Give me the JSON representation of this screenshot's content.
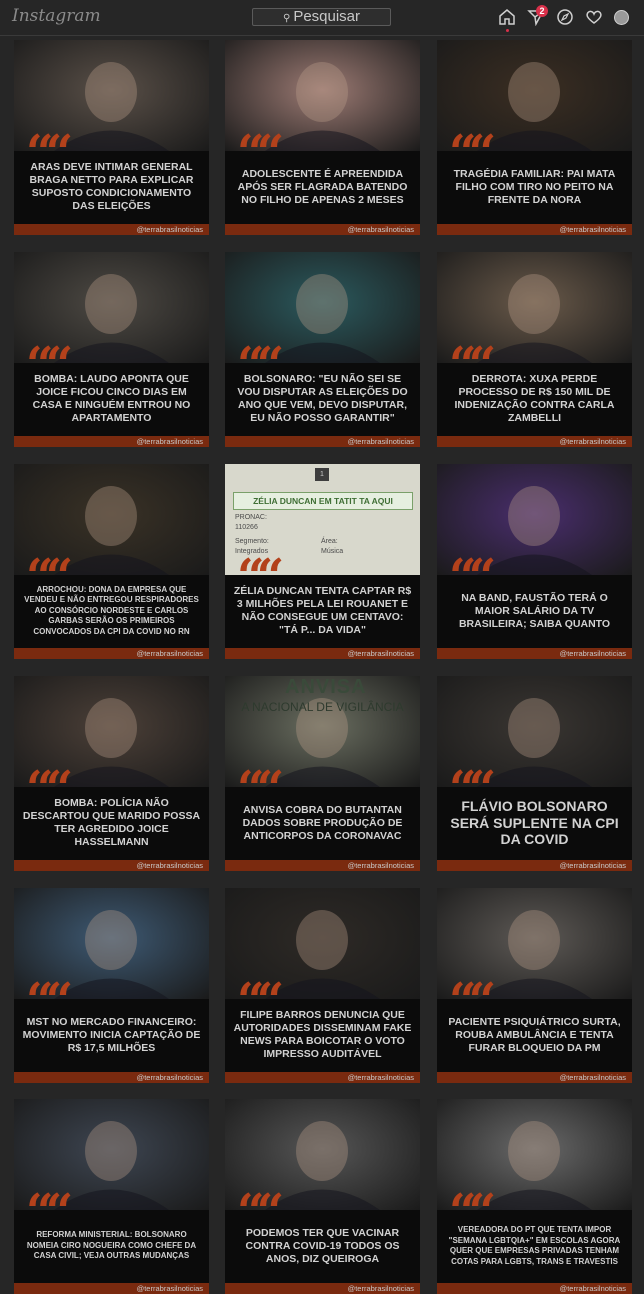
{
  "app": {
    "logo_text": "Instagram"
  },
  "search": {
    "placeholder": "Pesquisar"
  },
  "nav": {
    "notification_count": "2",
    "icons": [
      "home-icon",
      "direct-icon",
      "explore-icon",
      "heart-icon",
      "avatar"
    ]
  },
  "colors": {
    "accent": "#b3411b",
    "footer": "#7a2a0f",
    "badge": "#d9304a"
  },
  "handle": "@terrabrasilnoticias",
  "posts": [
    {
      "headline": "Aras deve intimar general Braga Netto para explicar suposto condicionamento das eleições",
      "photo": "portrait",
      "pc": "#5a5048"
    },
    {
      "headline": "Adolescente é apreendida após ser flagrada batendo no filho de apenas 2 meses",
      "photo": "baby-feet",
      "pc": "#9d7b74"
    },
    {
      "headline": "Tragédia familiar: pai mata filho com tiro no peito na frente da nora",
      "photo": "buildings-night",
      "pc": "#3b2e22"
    },
    {
      "headline": "Bomba: laudo aponta que Joice ficou cinco dias em casa e ninguém entrou no apartamento",
      "photo": "press",
      "pc": "#4e4a44"
    },
    {
      "headline": "Bolsonaro: \"Eu não sei se vou disputar as eleições do ano que vem, devo disputar, eu não posso garantir\"",
      "photo": "portrait-teal",
      "pc": "#2b5a5e"
    },
    {
      "headline": "Derrota: Xuxa perde processo de R$ 150 mil de indenização contra Carla Zambelli",
      "photo": "two-women",
      "pc": "#6a5a4a"
    },
    {
      "headline": "Arrochou: dona da empresa que vendeu e não entregou respiradores ao Consórcio Nordeste e Carlos Garbas serão os primeiros convocados da CPI da Covid no RN",
      "photo": "speaker",
      "pc": "#3a3226",
      "size": "small"
    },
    {
      "headline": "Zélia Duncan tenta captar R$ 3 milhões pela Lei Rouanet e não consegue um centavo: \"Tá p... da vida\"",
      "photo": "document",
      "pc": "#6e6e64",
      "card": {
        "title": "ZÉLIA DUNCAN EM TATIT TA AQUI",
        "l1": "PRONAC:",
        "v1": "110266",
        "l2": "Segmento:",
        "v2": "Integrados",
        "l3": "Área:",
        "v3": "Música",
        "page": "1"
      }
    },
    {
      "headline": "Na Band, Faustão terá o maior salário da TV brasileira; saiba quanto",
      "photo": "tv-host",
      "pc": "#4a2e6e"
    },
    {
      "headline": "Bomba: polícia não descartou que marido possa ter agredido Joice Hasselmann",
      "photo": "office",
      "pc": "#4c4038"
    },
    {
      "headline": "Anvisa cobra do Butantan dados sobre produção de anticorpos da Coronavac",
      "photo": "anvisa",
      "pc": "#6a6e60",
      "card": {
        "banner": "ANVISA",
        "sub": "A NACIONAL DE VIGILÂNCIA"
      }
    },
    {
      "headline": "Flávio Bolsonaro será suplente na CPI da Covid",
      "photo": "senator",
      "pc": "#3a3632",
      "size": "big"
    },
    {
      "headline": "MST no mercado financeiro: movimento inicia captação de R$ 17,5 milhões",
      "photo": "field-flag",
      "pc": "#3e5a74"
    },
    {
      "headline": "Filipe Barros denuncia que autoridades disseminam fake news para boicotar o voto impresso auditável",
      "photo": "hearing",
      "pc": "#2e2a26"
    },
    {
      "headline": "Paciente psiquiátrico surta, rouba ambulância e tenta furar bloqueio da PM",
      "photo": "street-cam",
      "pc": "#5e5a56"
    },
    {
      "headline": "Reforma ministerial: Bolsonaro nomeia Ciro Nogueira como chefe da Casa Civil; veja outras mudanças",
      "photo": "minister",
      "pc": "#3e4652",
      "size": "small"
    },
    {
      "headline": "Podemos ter que vacinar contra Covid-19 todos os anos, diz Queiroga",
      "photo": "masked",
      "pc": "#565656"
    },
    {
      "headline": "Vereadora do PT que tenta impor \"semana LGBTQIA+\" em escolas agora quer que empresas privadas tenham cotas para LGBTs, trans e travestis",
      "photo": "woman-smile",
      "pc": "#6a6a6a",
      "size": "small"
    }
  ]
}
